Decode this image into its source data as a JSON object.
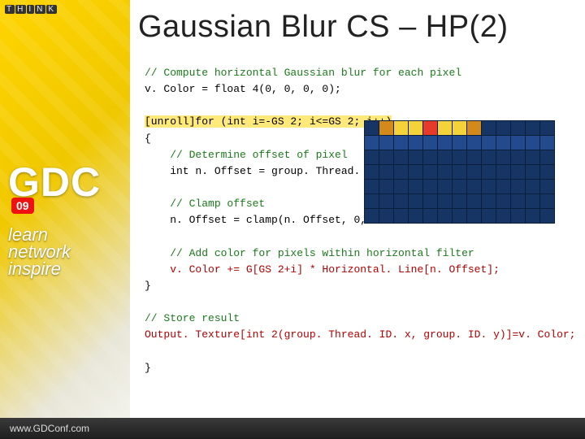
{
  "branding": {
    "think": "THINK",
    "gdc": "GDC",
    "year_badge": "09",
    "tagline_1": "learn",
    "tagline_2": "network",
    "tagline_3": "inspire",
    "footer": "www.GDConf.com"
  },
  "title": "Gaussian Blur CS – HP(2)",
  "code": {
    "l01": "// Compute horizontal Gaussian blur for each pixel",
    "l02": "v. Color = float 4(0, 0, 0, 0);",
    "l03a": "[unroll]for (int i=-GS 2; i<=GS 2; i++)",
    "l04": "{",
    "l05": "    // Determine offset of pixel",
    "l06": "    int n. Offset = group. Thread. ID.",
    "l07": "    // Clamp offset",
    "l08": "    n. Offset = clamp(n. Offset, 0,",
    "l09": "    // Add color for pixels within horizontal filter",
    "l10": "    v. Color += G[GS 2+i] * Horizontal. Line[n. Offset];",
    "l11": "}",
    "l12": "// Store result",
    "l13": "Output. Texture[int 2(group. Thread. ID. x, group. ID. y)]=v. Color;",
    "l14": "}"
  }
}
